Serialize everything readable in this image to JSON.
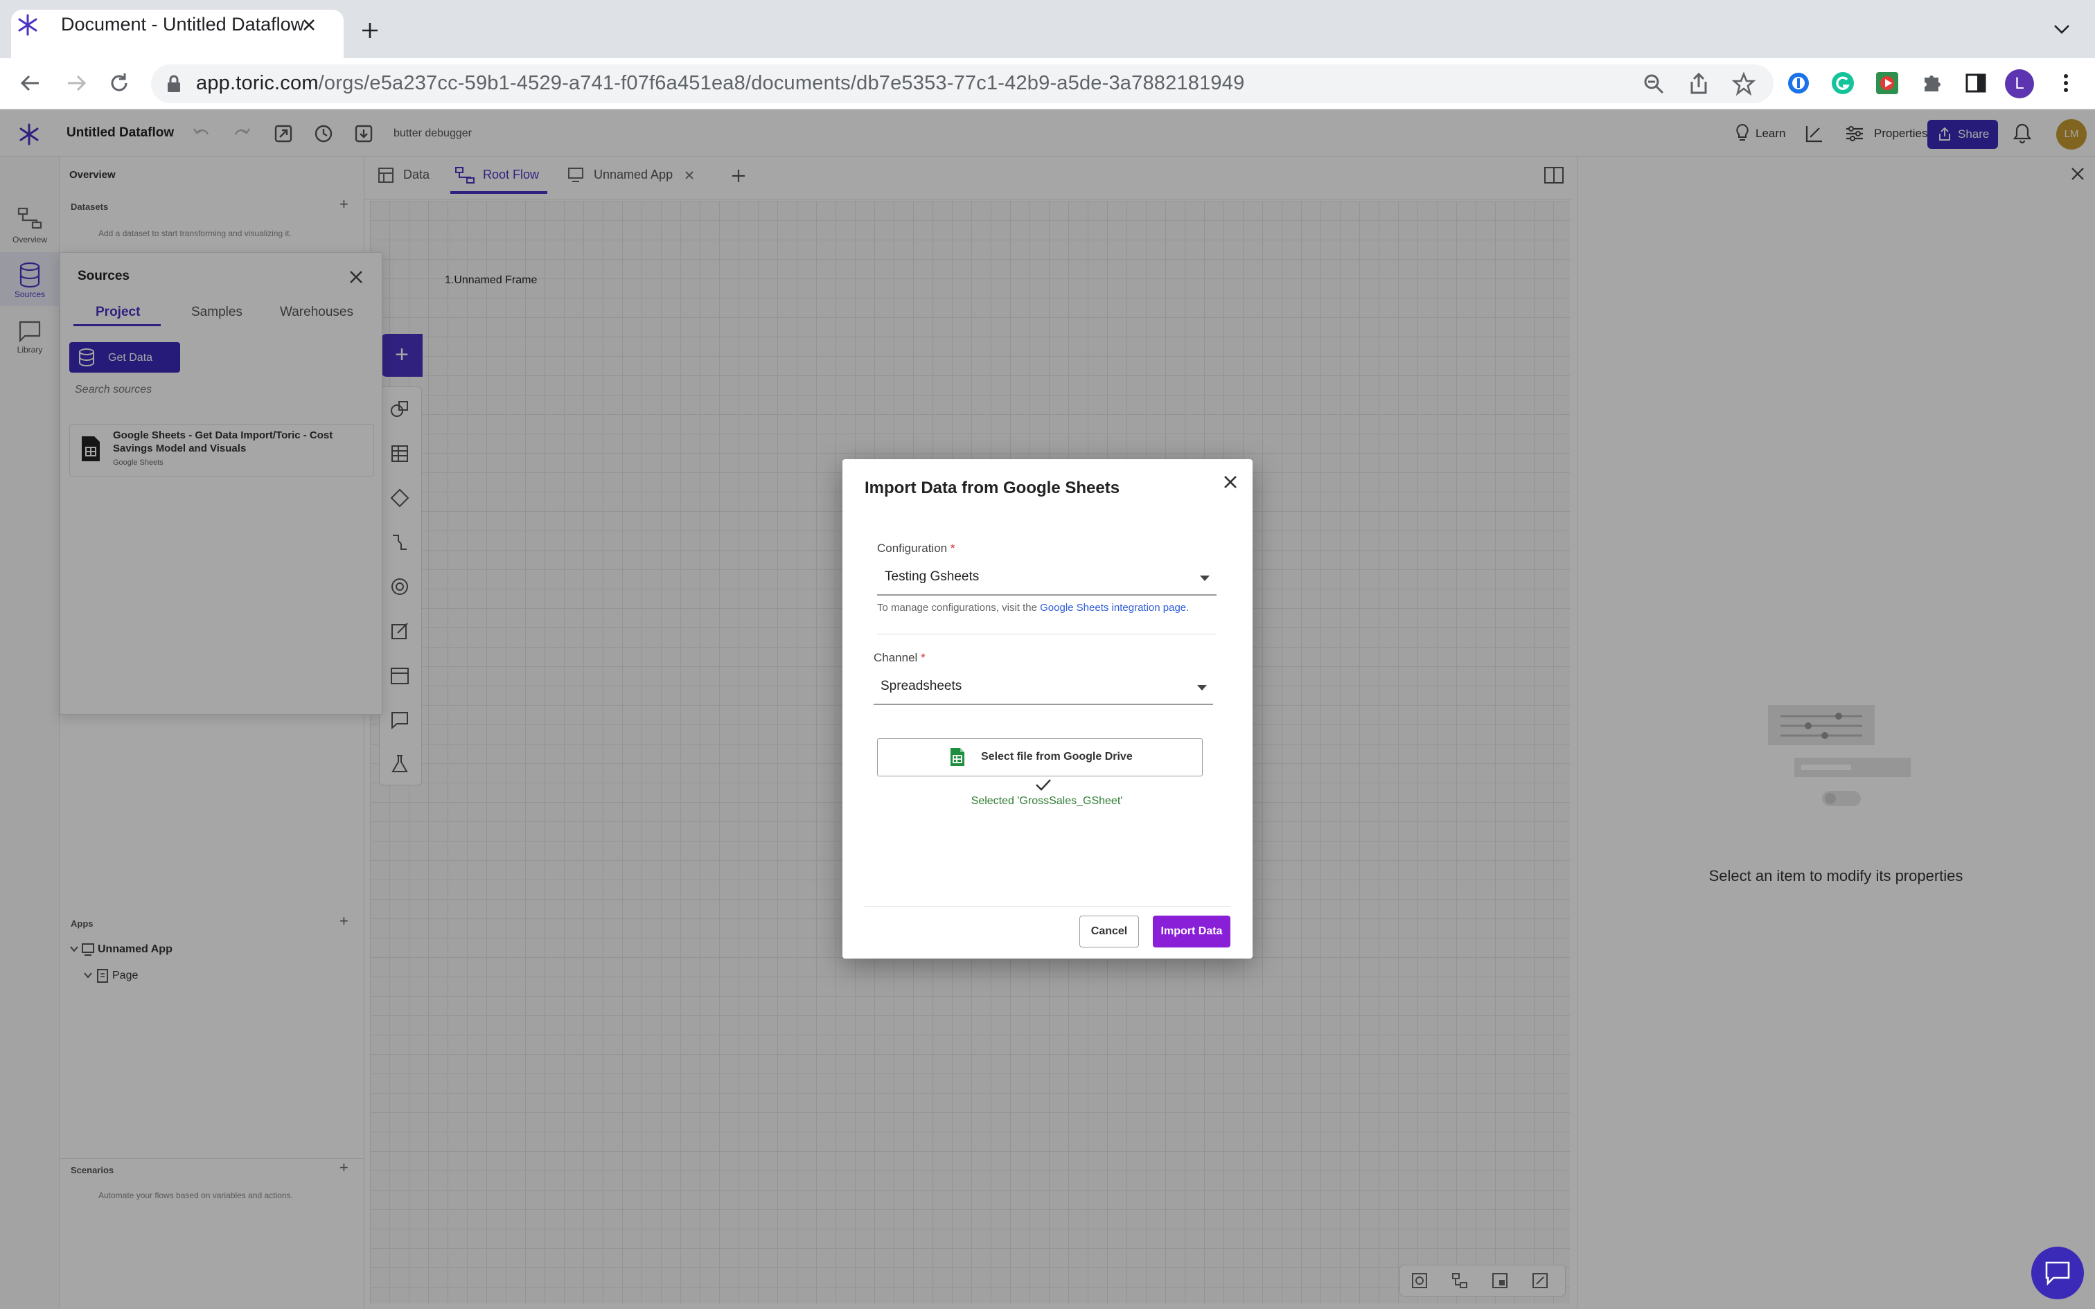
{
  "browser": {
    "tab_title": "Document - Untitled Dataflow",
    "url_host": "app.toric.com",
    "url_path": "/orgs/e5a237cc-59b1-4529-a741-f07f6a451ea8/documents/db7e5353-77c1-42b9-a5de-3a7882181949",
    "profile_initial": "L"
  },
  "header": {
    "doc_title": "Untitled Dataflow",
    "debug_label": "butter debugger",
    "learn_label": "Learn",
    "properties_label": "Properties",
    "share_label": "Share",
    "user_initials": "LM"
  },
  "rail": {
    "items": [
      {
        "label": "Overview",
        "icon": "flow-icon"
      },
      {
        "label": "Sources",
        "icon": "database-icon"
      },
      {
        "label": "Library",
        "icon": "chat-icon"
      }
    ]
  },
  "overview": {
    "title": "Overview",
    "datasets_title": "Datasets",
    "datasets_hint": "Add a dataset to start transforming and visualizing it.",
    "apps_title": "Apps",
    "app_item": "Unnamed App",
    "page_item": "Page",
    "scenarios_title": "Scenarios",
    "scenarios_hint": "Automate your flows based on variables and actions."
  },
  "doc_tabs": [
    {
      "label": "Data"
    },
    {
      "label": "Root Flow"
    },
    {
      "label": "Unnamed App"
    }
  ],
  "canvas": {
    "frame_label": "1.Unnamed Frame"
  },
  "right_panel": {
    "empty_text": "Select an item to modify its properties"
  },
  "sources": {
    "title": "Sources",
    "tabs": [
      "Project",
      "Samples",
      "Warehouses"
    ],
    "get_data_label": "Get Data",
    "search_placeholder": "Search sources",
    "card_title": "Google Sheets - Get Data Import/Toric - Cost Savings Model and Visuals",
    "card_subtitle": "Google Sheets"
  },
  "modal": {
    "title": "Import Data from Google Sheets",
    "configuration_label": "Configuration",
    "required_mark": "*",
    "configuration_value": "Testing Gsheets",
    "manage_hint": "To manage configurations, visit the ",
    "manage_link": "Google Sheets integration page.",
    "channel_label": "Channel",
    "channel_value": "Spreadsheets",
    "drive_button_label": "Select file from Google Drive",
    "selected_text": "Selected 'GrossSales_GSheet'",
    "cancel_label": "Cancel",
    "import_label": "Import Data"
  },
  "colors": {
    "accent": "#4b33c4",
    "import_button": "#8a1fd8",
    "success": "#2e7d32",
    "link": "#2f5bd8"
  }
}
